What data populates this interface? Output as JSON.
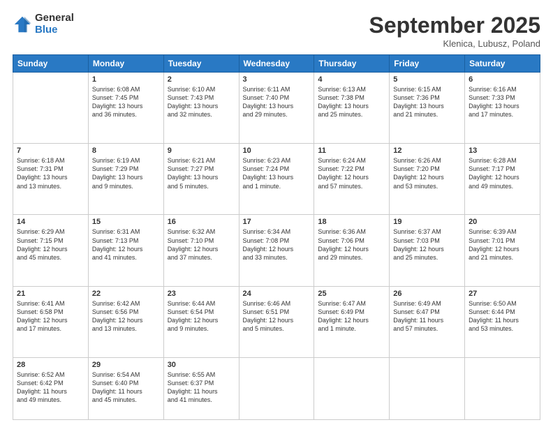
{
  "header": {
    "logo_general": "General",
    "logo_blue": "Blue",
    "title": "September 2025",
    "location": "Klenica, Lubusz, Poland"
  },
  "days_of_week": [
    "Sunday",
    "Monday",
    "Tuesday",
    "Wednesday",
    "Thursday",
    "Friday",
    "Saturday"
  ],
  "weeks": [
    [
      {
        "day": "",
        "text": ""
      },
      {
        "day": "1",
        "text": "Sunrise: 6:08 AM\nSunset: 7:45 PM\nDaylight: 13 hours\nand 36 minutes."
      },
      {
        "day": "2",
        "text": "Sunrise: 6:10 AM\nSunset: 7:43 PM\nDaylight: 13 hours\nand 32 minutes."
      },
      {
        "day": "3",
        "text": "Sunrise: 6:11 AM\nSunset: 7:40 PM\nDaylight: 13 hours\nand 29 minutes."
      },
      {
        "day": "4",
        "text": "Sunrise: 6:13 AM\nSunset: 7:38 PM\nDaylight: 13 hours\nand 25 minutes."
      },
      {
        "day": "5",
        "text": "Sunrise: 6:15 AM\nSunset: 7:36 PM\nDaylight: 13 hours\nand 21 minutes."
      },
      {
        "day": "6",
        "text": "Sunrise: 6:16 AM\nSunset: 7:33 PM\nDaylight: 13 hours\nand 17 minutes."
      }
    ],
    [
      {
        "day": "7",
        "text": "Sunrise: 6:18 AM\nSunset: 7:31 PM\nDaylight: 13 hours\nand 13 minutes."
      },
      {
        "day": "8",
        "text": "Sunrise: 6:19 AM\nSunset: 7:29 PM\nDaylight: 13 hours\nand 9 minutes."
      },
      {
        "day": "9",
        "text": "Sunrise: 6:21 AM\nSunset: 7:27 PM\nDaylight: 13 hours\nand 5 minutes."
      },
      {
        "day": "10",
        "text": "Sunrise: 6:23 AM\nSunset: 7:24 PM\nDaylight: 13 hours\nand 1 minute."
      },
      {
        "day": "11",
        "text": "Sunrise: 6:24 AM\nSunset: 7:22 PM\nDaylight: 12 hours\nand 57 minutes."
      },
      {
        "day": "12",
        "text": "Sunrise: 6:26 AM\nSunset: 7:20 PM\nDaylight: 12 hours\nand 53 minutes."
      },
      {
        "day": "13",
        "text": "Sunrise: 6:28 AM\nSunset: 7:17 PM\nDaylight: 12 hours\nand 49 minutes."
      }
    ],
    [
      {
        "day": "14",
        "text": "Sunrise: 6:29 AM\nSunset: 7:15 PM\nDaylight: 12 hours\nand 45 minutes."
      },
      {
        "day": "15",
        "text": "Sunrise: 6:31 AM\nSunset: 7:13 PM\nDaylight: 12 hours\nand 41 minutes."
      },
      {
        "day": "16",
        "text": "Sunrise: 6:32 AM\nSunset: 7:10 PM\nDaylight: 12 hours\nand 37 minutes."
      },
      {
        "day": "17",
        "text": "Sunrise: 6:34 AM\nSunset: 7:08 PM\nDaylight: 12 hours\nand 33 minutes."
      },
      {
        "day": "18",
        "text": "Sunrise: 6:36 AM\nSunset: 7:06 PM\nDaylight: 12 hours\nand 29 minutes."
      },
      {
        "day": "19",
        "text": "Sunrise: 6:37 AM\nSunset: 7:03 PM\nDaylight: 12 hours\nand 25 minutes."
      },
      {
        "day": "20",
        "text": "Sunrise: 6:39 AM\nSunset: 7:01 PM\nDaylight: 12 hours\nand 21 minutes."
      }
    ],
    [
      {
        "day": "21",
        "text": "Sunrise: 6:41 AM\nSunset: 6:58 PM\nDaylight: 12 hours\nand 17 minutes."
      },
      {
        "day": "22",
        "text": "Sunrise: 6:42 AM\nSunset: 6:56 PM\nDaylight: 12 hours\nand 13 minutes."
      },
      {
        "day": "23",
        "text": "Sunrise: 6:44 AM\nSunset: 6:54 PM\nDaylight: 12 hours\nand 9 minutes."
      },
      {
        "day": "24",
        "text": "Sunrise: 6:46 AM\nSunset: 6:51 PM\nDaylight: 12 hours\nand 5 minutes."
      },
      {
        "day": "25",
        "text": "Sunrise: 6:47 AM\nSunset: 6:49 PM\nDaylight: 12 hours\nand 1 minute."
      },
      {
        "day": "26",
        "text": "Sunrise: 6:49 AM\nSunset: 6:47 PM\nDaylight: 11 hours\nand 57 minutes."
      },
      {
        "day": "27",
        "text": "Sunrise: 6:50 AM\nSunset: 6:44 PM\nDaylight: 11 hours\nand 53 minutes."
      }
    ],
    [
      {
        "day": "28",
        "text": "Sunrise: 6:52 AM\nSunset: 6:42 PM\nDaylight: 11 hours\nand 49 minutes."
      },
      {
        "day": "29",
        "text": "Sunrise: 6:54 AM\nSunset: 6:40 PM\nDaylight: 11 hours\nand 45 minutes."
      },
      {
        "day": "30",
        "text": "Sunrise: 6:55 AM\nSunset: 6:37 PM\nDaylight: 11 hours\nand 41 minutes."
      },
      {
        "day": "",
        "text": ""
      },
      {
        "day": "",
        "text": ""
      },
      {
        "day": "",
        "text": ""
      },
      {
        "day": "",
        "text": ""
      }
    ]
  ]
}
